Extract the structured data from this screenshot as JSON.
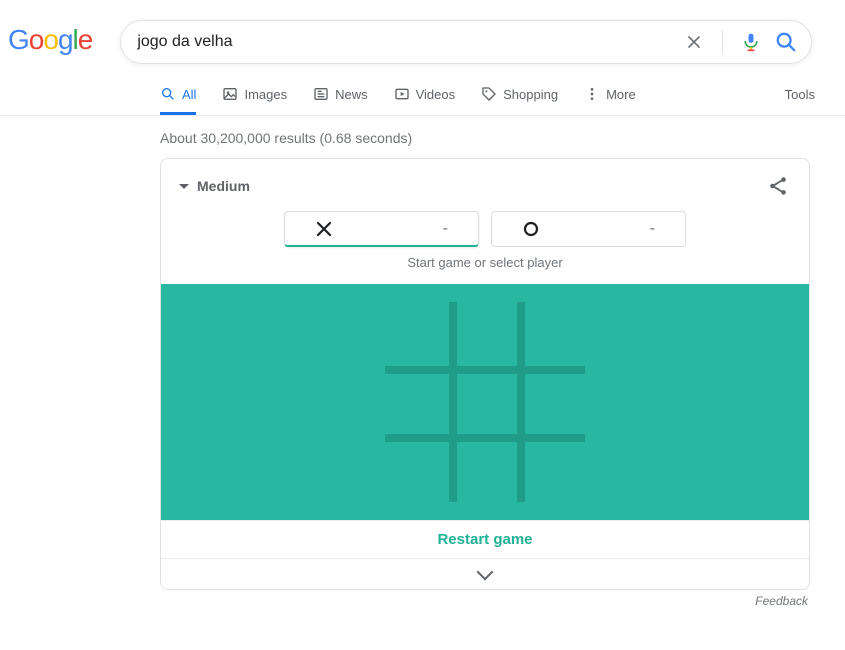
{
  "search": {
    "query": "jogo da velha"
  },
  "tabs": {
    "all": "All",
    "images": "Images",
    "news": "News",
    "videos": "Videos",
    "shopping": "Shopping",
    "more": "More",
    "tools": "Tools"
  },
  "results": {
    "meta": "About 30,200,000 results (0.68 seconds)"
  },
  "game": {
    "difficulty": "Medium",
    "score_x": "-",
    "score_o": "-",
    "start_msg": "Start game or select player",
    "restart": "Restart game"
  },
  "feedback": "Feedback"
}
